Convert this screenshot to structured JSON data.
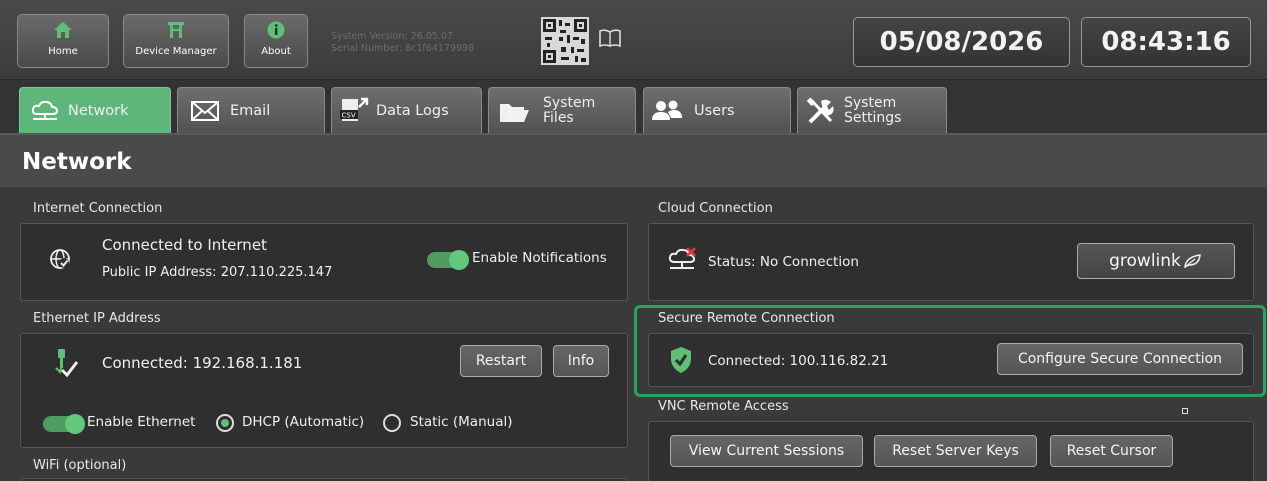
{
  "topbar": {
    "buttons": [
      {
        "label": "Home",
        "icon": "home-icon"
      },
      {
        "label": "Device Manager",
        "icon": "device-manager-icon"
      },
      {
        "label": "About",
        "icon": "info-icon"
      }
    ],
    "system_version": "System Version: 26.05.07",
    "serial_number": "Serial Number: 8c1f64179998",
    "date": "05/08/2026",
    "time": "08:43:16"
  },
  "tabs": [
    {
      "label": "Network",
      "active": true
    },
    {
      "label": "Email"
    },
    {
      "label": "Data Logs"
    },
    {
      "label": "System Files"
    },
    {
      "label": "Users"
    },
    {
      "label": "System Settings"
    }
  ],
  "page_title": "Network",
  "internet": {
    "section": "Internet Connection",
    "status": "Connected to Internet",
    "public_ip": "Public IP Address: 207.110.225.147",
    "notifications_label": "Enable Notifications",
    "notifications_on": true
  },
  "ethernet": {
    "section": "Ethernet IP Address",
    "status": "Connected: 192.168.1.181",
    "restart": "Restart",
    "info": "Info",
    "enable_label": "Enable Ethernet",
    "dhcp_label": "DHCP (Automatic)",
    "static_label": "Static (Manual)",
    "mode": "DHCP (Automatic)"
  },
  "wifi": {
    "section": "WiFi (optional)"
  },
  "cloud": {
    "section": "Cloud Connection",
    "status": "Status: No Connection",
    "brand_button": "growlink"
  },
  "secure": {
    "section": "Secure Remote Connection",
    "status": "Connected: 100.116.82.21",
    "configure": "Configure Secure Connection"
  },
  "vnc": {
    "section": "VNC Remote Access",
    "view_sessions": "View Current Sessions",
    "reset_keys": "Reset Server Keys",
    "reset_cursor": "Reset Cursor"
  },
  "colors": {
    "accent": "#5eb67b",
    "highlight": "#2aa35a",
    "warning": "#e03a3a"
  }
}
